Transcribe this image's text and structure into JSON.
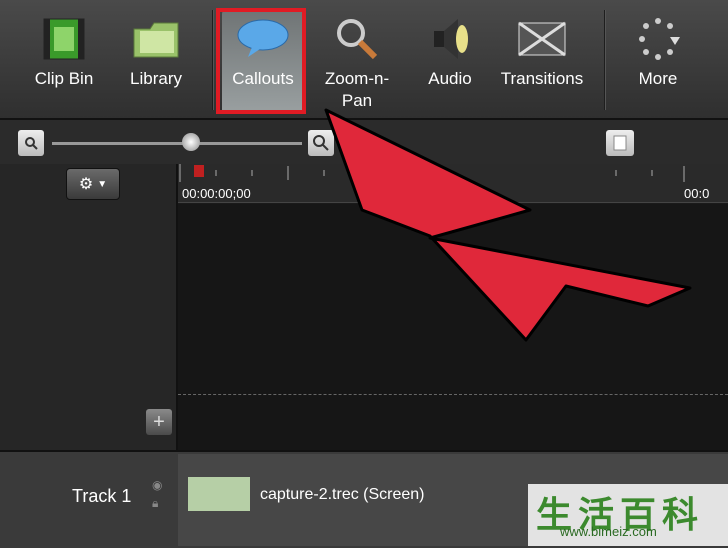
{
  "toolbar": {
    "items": [
      {
        "label": "Clip Bin"
      },
      {
        "label": "Library"
      },
      {
        "label": "Callouts"
      },
      {
        "label": "Zoom-n-\nPan"
      },
      {
        "label": "Audio"
      },
      {
        "label": "Transitions"
      },
      {
        "label": "More"
      }
    ]
  },
  "timeline": {
    "timecode_start": "00:00:00;00",
    "timecode_end": "00:0"
  },
  "track": {
    "name": "Track 1",
    "clip_name": "capture-2.trec (Screen)"
  },
  "watermark": {
    "title": "生活百科",
    "url": "www.bimeiz.com"
  },
  "colors": {
    "highlight": "#e01b24",
    "arrow": "#e0283a",
    "clip_thumb": "#b6cfa6"
  }
}
